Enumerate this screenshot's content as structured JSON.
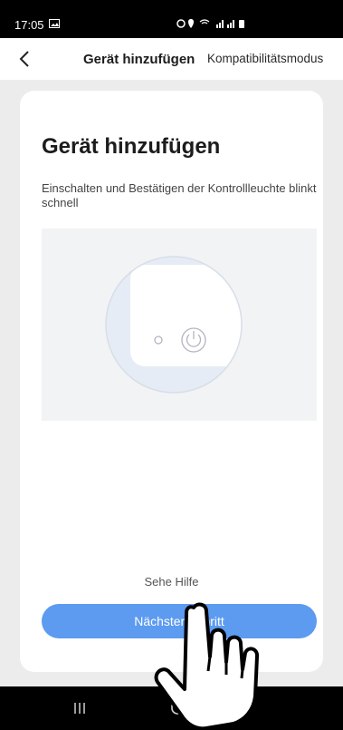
{
  "status_bar": {
    "time": "17:05"
  },
  "header": {
    "title": "Gerät hinzufügen",
    "compat_mode": "Kompatibilitätsmodus"
  },
  "card": {
    "title": "Gerät hinzufügen",
    "description": "Einschalten und Bestätigen der Kontrollleuchte blinkt schnell",
    "help_link": "Sehe Hilfe",
    "next_button": "Nächster Schritt"
  },
  "colors": {
    "accent_button": "#5c9bf0",
    "card_background": "#ffffff",
    "page_background": "#ececec"
  }
}
